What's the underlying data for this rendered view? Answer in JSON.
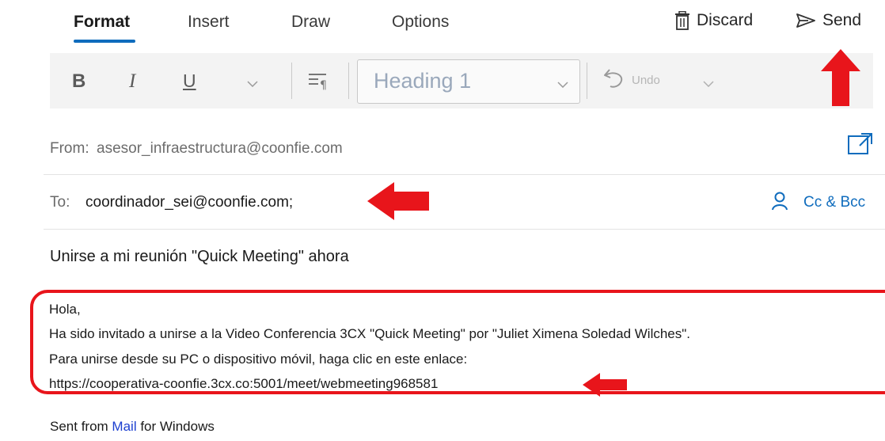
{
  "tabs": [
    {
      "label": "Format",
      "active": true
    },
    {
      "label": "Insert",
      "active": false
    },
    {
      "label": "Draw",
      "active": false
    },
    {
      "label": "Options",
      "active": false
    }
  ],
  "actions": {
    "discard_label": "Discard",
    "send_label": "Send"
  },
  "ribbon": {
    "bold": "B",
    "italic": "I",
    "underline": "U",
    "style_value": "Heading 1",
    "undo_label": "Undo"
  },
  "from": {
    "label": "From:",
    "value": "asesor_infraestructura@coonfie.com"
  },
  "to": {
    "label": "To:",
    "value": "coordinador_sei@coonfie.com;",
    "cc_bcc_label": "Cc & Bcc"
  },
  "subject": "Unirse a mi reunión \"Quick Meeting\" ahora",
  "body": {
    "lines": [
      "Hola,",
      "Ha sido invitado a unirse a la Video Conferencia 3CX \"Quick Meeting\" por \"Juliet Ximena Soledad Wilches\".",
      "Para unirse desde su PC o dispositivo móvil, haga clic en este enlace:",
      "https://cooperativa-coonfie.3cx.co:5001/meet/webmeeting968581"
    ]
  },
  "signature": {
    "prefix": "Sent from ",
    "link": "Mail",
    "suffix": " for Windows"
  },
  "colors": {
    "accent": "#0f6cbd",
    "annotation_red": "#e8151b",
    "ribbon_bg": "#f3f3f3"
  }
}
